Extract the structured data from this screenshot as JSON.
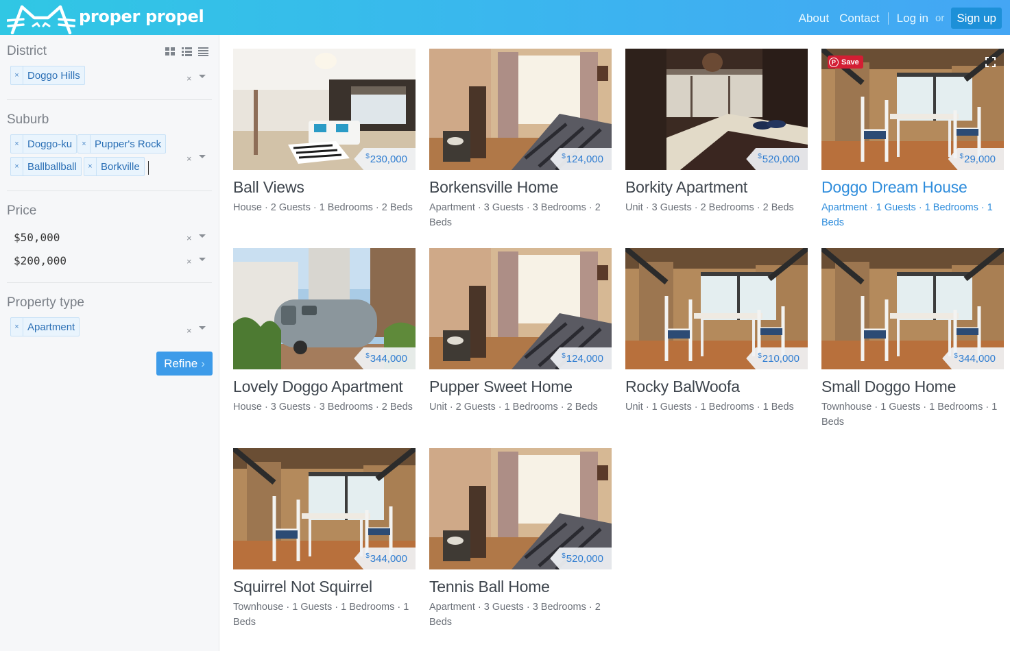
{
  "header": {
    "brand": "proper propel",
    "nav": {
      "about": "About",
      "contact": "Contact",
      "login": "Log in",
      "or": "or",
      "signup": "Sign up"
    }
  },
  "sidebar": {
    "district": {
      "title": "District",
      "tags": [
        "Doggo Hills"
      ]
    },
    "suburb": {
      "title": "Suburb",
      "tags": [
        "Doggo-ku",
        "Pupper's Rock",
        "Ballballball",
        "Borkville"
      ]
    },
    "price": {
      "title": "Price",
      "min": "$50,000",
      "max": "$200,000"
    },
    "property_type": {
      "title": "Property type",
      "tags": [
        "Apartment"
      ]
    },
    "refine_label": "Refine",
    "remove_glyph": "×"
  },
  "listings": [
    {
      "title": "Ball Views",
      "price": "230,000",
      "meta": "House · 2 Guests · 1 Bedrooms · 2 Beds",
      "photo": "living"
    },
    {
      "title": "Borkensville Home",
      "price": "124,000",
      "meta": "Apartment · 3 Guests · 3 Bedrooms · 2 Beds",
      "photo": "bedroom"
    },
    {
      "title": "Borkity Apartment",
      "price": "520,000",
      "meta": "Unit · 3 Guests · 2 Bedrooms · 2 Beds",
      "photo": "dark"
    },
    {
      "title": "Doggo Dream House",
      "price": "29,000",
      "meta": "Apartment · 1 Guests · 1 Bedrooms · 1 Beds",
      "photo": "dining",
      "highlight": true,
      "save_label": "Save"
    },
    {
      "title": "Lovely Doggo Apartment",
      "price": "344,000",
      "meta": "House · 3 Guests · 3 Bedrooms · 2 Beds",
      "photo": "trailer"
    },
    {
      "title": "Pupper Sweet Home",
      "price": "124,000",
      "meta": "Unit · 2 Guests · 1 Bedrooms · 2 Beds",
      "photo": "bedroom"
    },
    {
      "title": "Rocky BalWoofa",
      "price": "210,000",
      "meta": "Unit · 1 Guests · 1 Bedrooms · 1 Beds",
      "photo": "dining"
    },
    {
      "title": "Small Doggo Home",
      "price": "344,000",
      "meta": "Townhouse · 1 Guests · 1 Bedrooms · 1 Beds",
      "photo": "dining"
    },
    {
      "title": "Squirrel Not Squirrel",
      "price": "344,000",
      "meta": "Townhouse · 1 Guests · 1 Bedrooms · 1 Beds",
      "photo": "dining"
    },
    {
      "title": "Tennis Ball Home",
      "price": "520,000",
      "meta": "Apartment · 3 Guests · 3 Bedrooms · 2 Beds",
      "photo": "bedroom"
    }
  ],
  "currency_symbol": "$",
  "colors": {
    "header_start": "#30c7e4",
    "header_end": "#44a6f4",
    "accent": "#2f8ddc",
    "refine": "#3d9be9",
    "pinterest": "#d31e33"
  },
  "icons": [
    "logo-cat-icon",
    "grid-view-icon",
    "list-view-icon",
    "compact-view-icon",
    "clear-icon",
    "dropdown-caret-icon",
    "chevron-right-icon",
    "pinterest-icon",
    "expand-icon"
  ]
}
